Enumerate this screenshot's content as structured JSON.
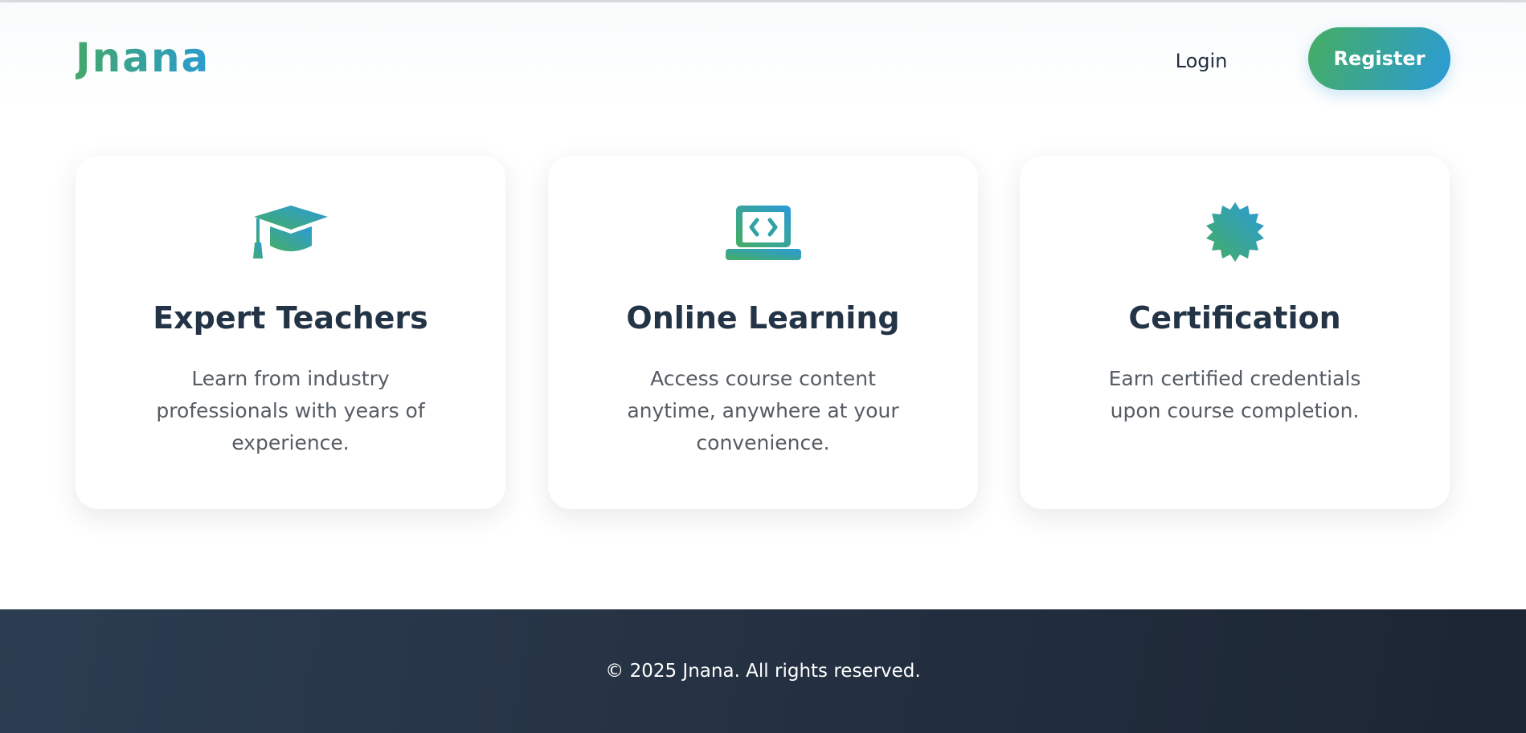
{
  "header": {
    "logo": "Jnana",
    "login_label": "Login",
    "register_label": "Register"
  },
  "features": [
    {
      "icon": "graduation-cap-icon",
      "title": "Expert Teachers",
      "description": "Learn from industry professionals with years of experience."
    },
    {
      "icon": "laptop-code-icon",
      "title": "Online Learning",
      "description": "Access course content anytime, anywhere at your convenience."
    },
    {
      "icon": "certificate-badge-icon",
      "title": "Certification",
      "description": "Earn certified credentials upon course completion."
    }
  ],
  "footer": {
    "copyright": "© 2025 Jnana. All rights reserved."
  },
  "colors": {
    "brand_green": "#43a86a",
    "brand_blue": "#2a9bd0",
    "heading": "#243447",
    "footer_bg": "#1f2a38"
  }
}
